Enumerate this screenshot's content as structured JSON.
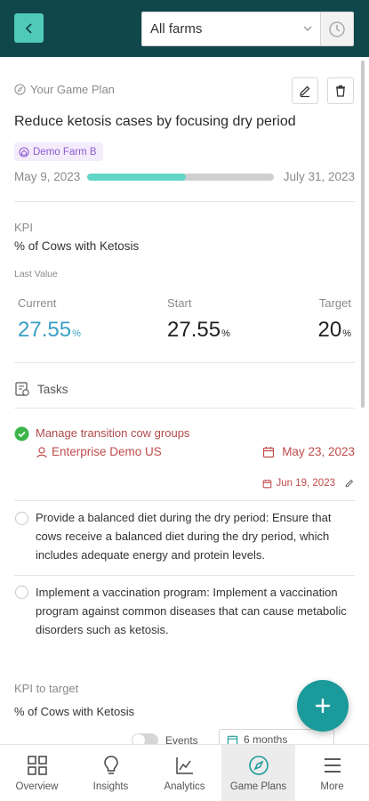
{
  "header": {
    "farm_select_value": "All farms"
  },
  "game_plan": {
    "section_label": "Your Game Plan",
    "title": "Reduce ketosis cases by focusing dry period",
    "farm_badge": "Demo Farm B",
    "start_date": "May 9, 2023",
    "end_date": "July 31, 2023",
    "progress_fraction": 0.53
  },
  "kpi": {
    "label": "KPI",
    "name": "% of Cows with Ketosis",
    "last_value_label": "Last Value",
    "current_label": "Current",
    "current_value": "27.55",
    "start_label": "Start",
    "start_value": "27.55",
    "target_label": "Target",
    "target_value": "20",
    "unit": "%"
  },
  "tasks": {
    "heading": "Tasks",
    "items": [
      {
        "title": "Manage transition cow groups",
        "owner": "Enterprise Demo US",
        "due_date": "May 23, 2023",
        "completed_date": "Jun 19, 2023",
        "status": "done"
      },
      {
        "text": "Provide a balanced diet during the dry period: Ensure that cows receive a balanced diet during the dry period, which includes adequate energy and protein levels.",
        "status": "open"
      },
      {
        "text": "Implement a vaccination program: Implement a vaccination program against common diseases that can cause metabolic disorders such as ketosis.",
        "status": "open"
      }
    ]
  },
  "kpi_to_target": {
    "label": "KPI to target",
    "name": "% of Cows with Ketosis",
    "events_label": "Events",
    "period_value": "6 months"
  },
  "bottom_nav": {
    "items": [
      {
        "label": "Overview",
        "icon": "overview-icon"
      },
      {
        "label": "Insights",
        "icon": "lightbulb-icon"
      },
      {
        "label": "Analytics",
        "icon": "analytics-icon"
      },
      {
        "label": "Game Plans",
        "icon": "compass-icon",
        "active": true
      },
      {
        "label": "More",
        "icon": "menu-icon"
      }
    ]
  },
  "colors": {
    "header_bg": "#10474a",
    "accent": "#4fc9b8",
    "fab": "#1a9a9a",
    "current_value": "#3a9fc7",
    "task_done": "#c04b4b",
    "badge_text": "#8b5bd0"
  }
}
